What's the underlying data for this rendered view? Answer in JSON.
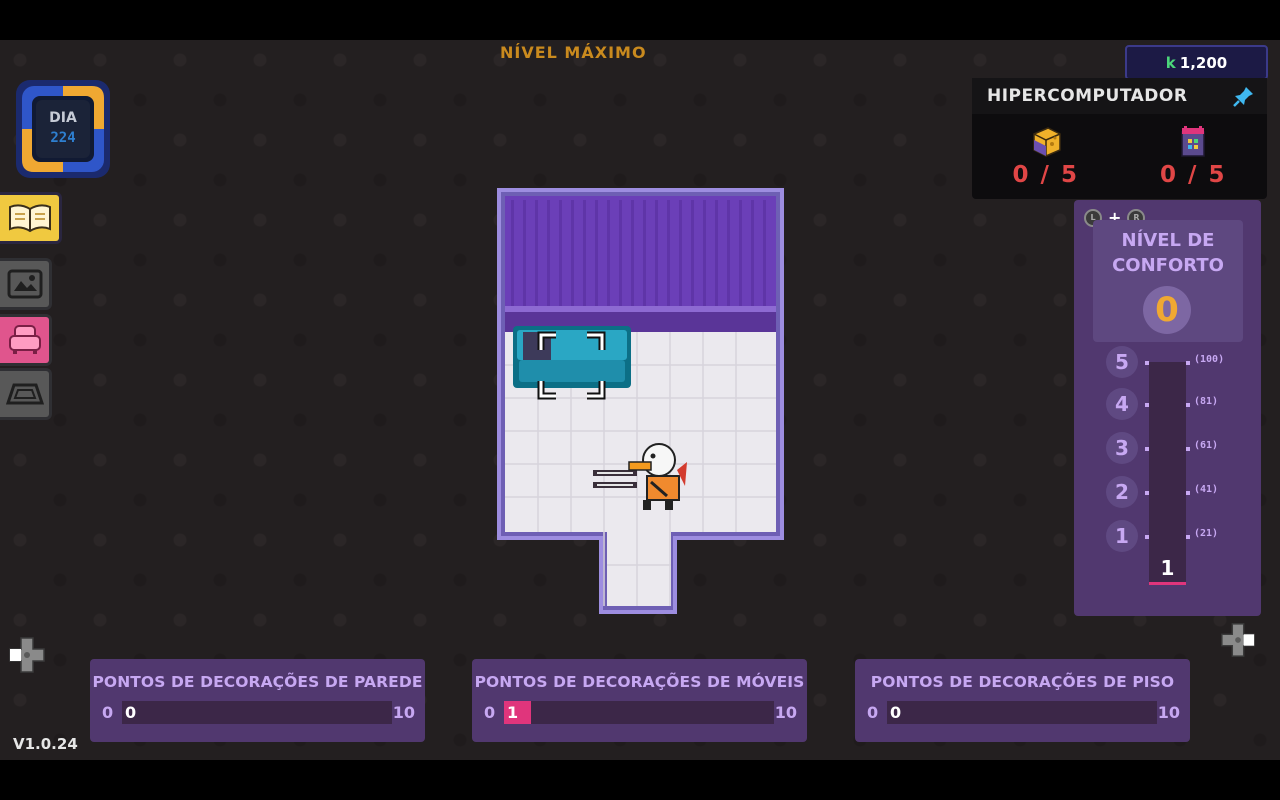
{
  "header": {
    "max_level": "NÍVEL MÁXIMO",
    "currency_symbol": "k",
    "currency_value": "1,200"
  },
  "day": {
    "label": "DIA",
    "value": "224"
  },
  "hypercomputer": {
    "title": "HIPERCOMPUTADOR",
    "items": [
      {
        "icon": "cheese-cube-icon",
        "count": "0 / 5"
      },
      {
        "icon": "chip-box-icon",
        "count": "0 / 5"
      }
    ]
  },
  "sidebar": {
    "items": [
      {
        "icon": "book-icon",
        "active": true
      },
      {
        "icon": "picture-frame-icon",
        "active": false
      },
      {
        "icon": "armchair-icon",
        "active": false
      },
      {
        "icon": "rug-icon",
        "active": false
      }
    ]
  },
  "comfort": {
    "buttons": {
      "left": "L",
      "right": "R"
    },
    "title_line1": "NÍVEL DE",
    "title_line2": "CONFORTO",
    "value": "0",
    "current_bar_value": "1",
    "levels": [
      {
        "level": "5",
        "requirement": "(100)"
      },
      {
        "level": "4",
        "requirement": "(81)"
      },
      {
        "level": "3",
        "requirement": "(61)"
      },
      {
        "level": "2",
        "requirement": "(41)"
      },
      {
        "level": "1",
        "requirement": "(21)"
      }
    ]
  },
  "decorations": [
    {
      "title": "PONTOS DE DECORAÇÕES DE PAREDE",
      "min": "0",
      "max": "10",
      "value": "0",
      "fraction": 0.0
    },
    {
      "title": "PONTOS DE DECORAÇÕES DE MÓVEIS",
      "min": "0",
      "max": "10",
      "value": "1",
      "fraction": 0.1
    },
    {
      "title": "PONTOS DE DECORAÇÕES DE PISO",
      "min": "0",
      "max": "10",
      "value": "0",
      "fraction": 0.0
    }
  ],
  "version": "V1.0.24",
  "colors": {
    "accent_gold": "#c98a1e",
    "panel_purple": "#51386f",
    "bar_pink": "#e0357c",
    "count_red": "#e04646",
    "wall_purple": "#6b3fb8"
  }
}
